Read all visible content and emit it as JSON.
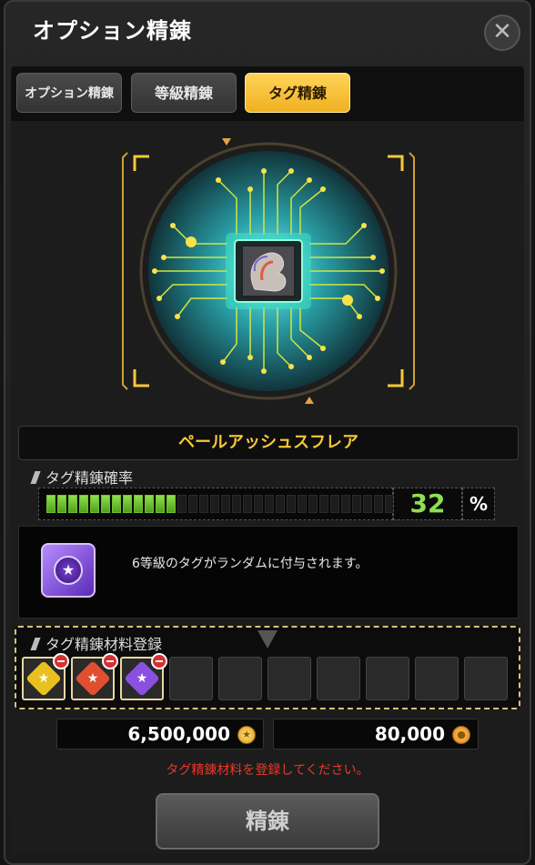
{
  "window": {
    "title": "オプション精錬",
    "close_icon": "close-icon"
  },
  "tabs": [
    {
      "label": "オプション精錬",
      "active": false
    },
    {
      "label": "等級精錬",
      "active": false
    },
    {
      "label": "タグ精錬",
      "active": true
    }
  ],
  "item": {
    "name": "ペールアッシュスフレア",
    "icon": "flame-crest-icon"
  },
  "probability": {
    "header": "タグ精錬確率",
    "value": "32",
    "unit": "%",
    "fraction": 0.32,
    "segments": 36
  },
  "info": {
    "text": "6等級のタグがランダムに付与されます。",
    "icon": "purple-star-tag-icon"
  },
  "materials": {
    "header": "タグ精錬材料登録",
    "slots": [
      {
        "filled": true,
        "color": "#e8c020",
        "icon": "gold-star-tag-icon"
      },
      {
        "filled": true,
        "color": "#e05030",
        "icon": "red-star-tag-icon"
      },
      {
        "filled": true,
        "color": "#8a50e0",
        "icon": "purple-star-tag-icon"
      },
      {
        "filled": false
      },
      {
        "filled": false
      },
      {
        "filled": false
      },
      {
        "filled": false
      },
      {
        "filled": false
      },
      {
        "filled": false
      },
      {
        "filled": false
      }
    ]
  },
  "costs": {
    "gold": "6,500,000",
    "gold_icon": "gold-coin-icon",
    "point": "80,000",
    "point_icon": "orange-coin-icon"
  },
  "warning": "タグ精錬材料を登録してください。",
  "action": {
    "refine_label": "精錬"
  },
  "colors": {
    "accent": "#f7c838",
    "gauge": "#8fe050",
    "warning": "#e83a2a",
    "circuit": "#cfe83a"
  }
}
